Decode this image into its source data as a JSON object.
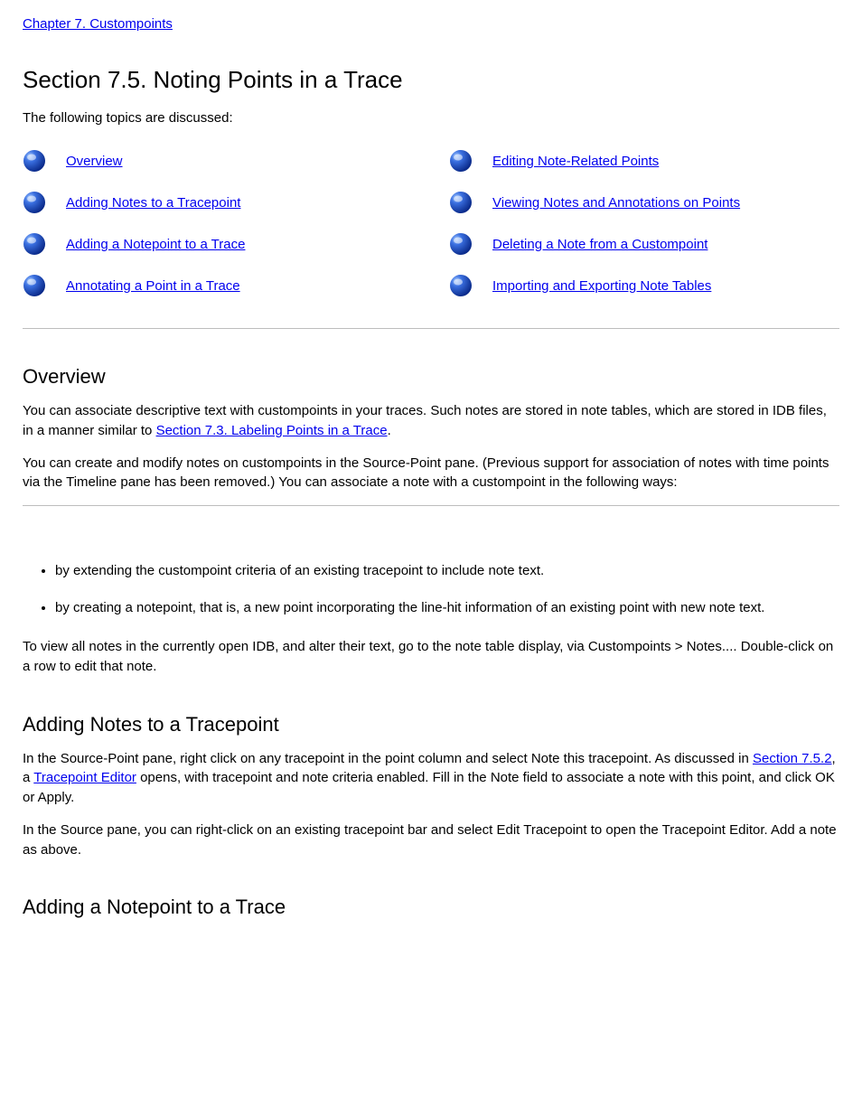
{
  "chapter_link": "Chapter 7. Custompoints",
  "section_title": "Section 7.5. Noting Points in a Trace",
  "topics_intro": "The following topics are discussed:",
  "topics_left": [
    {
      "label": "Overview"
    },
    {
      "label": "Adding Notes to a Tracepoint"
    },
    {
      "label": "Adding a Notepoint to a Trace"
    },
    {
      "label": "Annotating a Point in a Trace"
    }
  ],
  "topics_right": [
    {
      "label": "Editing Note-Related Points"
    },
    {
      "label": "Viewing Notes and Annotations on Points"
    },
    {
      "label": "Deleting a Note from a Custompoint"
    },
    {
      "label": "Importing and Exporting Note Tables"
    }
  ],
  "overview": {
    "heading": "Overview",
    "p1_a": "You can associate descriptive text with custompoints in your traces. Such notes are stored in note tables, which are stored in IDB files, in a manner similar to ",
    "p1_link": "Section 7.3. Labeling Points in a Trace",
    "p1_b": ".",
    "p2": "You can create and modify notes on custompoints in the Source-Point pane. (Previous support for association of notes with time points via the Timeline pane has been removed.) You can associate a note with a custompoint in the following ways:",
    "bullets": [
      "by extending the custompoint criteria of an existing tracepoint to include note text.",
      "by creating a notepoint, that is, a new point incorporating the line-hit information of an existing point with new note text."
    ],
    "p3": "To view all notes in the currently open IDB, and alter their text, go to the note table display, via Custompoints > Notes.... Double-click on a row to edit that note."
  },
  "adding_notes": {
    "heading": "Adding Notes to a Tracepoint",
    "p1_a": "In the Source-Point pane, right click on any tracepoint in the point column and select Note this tracepoint. As discussed in ",
    "p1_link1": "Section 7.5.2",
    "p1_mid": ", a ",
    "p1_link2": "Tracepoint Editor",
    "p1_b": " opens, with tracepoint and note criteria enabled. Fill in the Note field to associate a note with this point, and click OK or Apply.",
    "p2": "In the Source pane, you can right-click on an existing tracepoint bar and select Edit Tracepoint to open the Tracepoint Editor. Add a note as above."
  },
  "adding_notepoint": {
    "heading": "Adding a Notepoint to a Trace"
  }
}
